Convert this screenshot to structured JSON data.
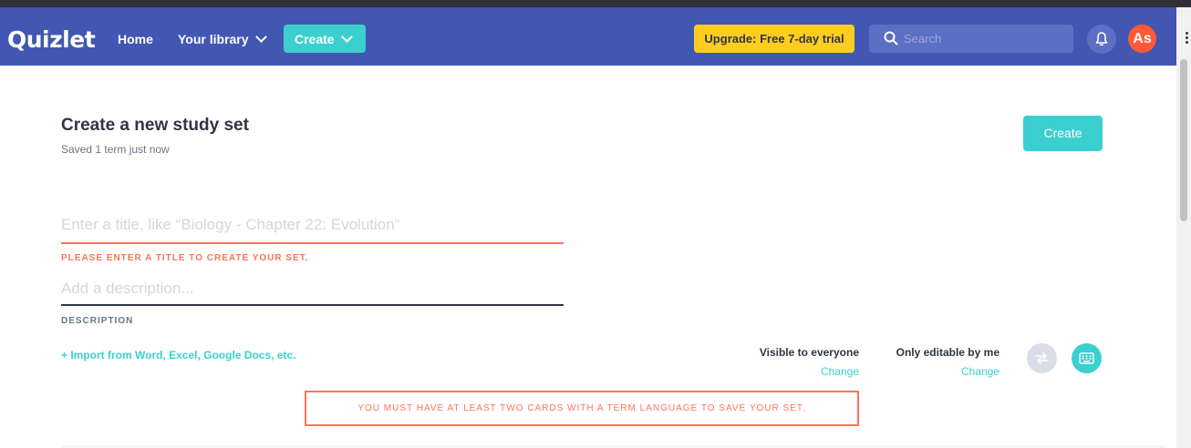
{
  "nav": {
    "logo": "Quizlet",
    "home": "Home",
    "library": "Your library",
    "create": "Create",
    "upgrade": "Upgrade: Free 7-day trial",
    "search_placeholder": "Search",
    "avatar": "As"
  },
  "page": {
    "title": "Create a new study set",
    "saved_status": "Saved 1 term just now",
    "create_button": "Create"
  },
  "form": {
    "title_placeholder": "Enter a title, like “Biology - Chapter 22: Evolution”",
    "title_value": "",
    "title_error": "PLEASE ENTER A TITLE TO CREATE YOUR SET.",
    "description_placeholder": "Add a description...",
    "description_value": "",
    "description_label": "DESCRIPTION",
    "import_link": "+ Import from Word, Excel, Google Docs, etc."
  },
  "permissions": {
    "visible_label": "Visible to everyone",
    "visible_change": "Change",
    "editable_label": "Only editable by me",
    "editable_change": "Change"
  },
  "warning": "YOU MUST HAVE AT LEAST TWO CARDS WITH A TERM LANGUAGE TO SAVE YOUR SET.",
  "colors": {
    "nav_bg": "#4257b2",
    "accent": "#3ccfcf",
    "upgrade": "#ffcd1f",
    "error": "#ff725b",
    "avatar": "#ff5a36"
  }
}
